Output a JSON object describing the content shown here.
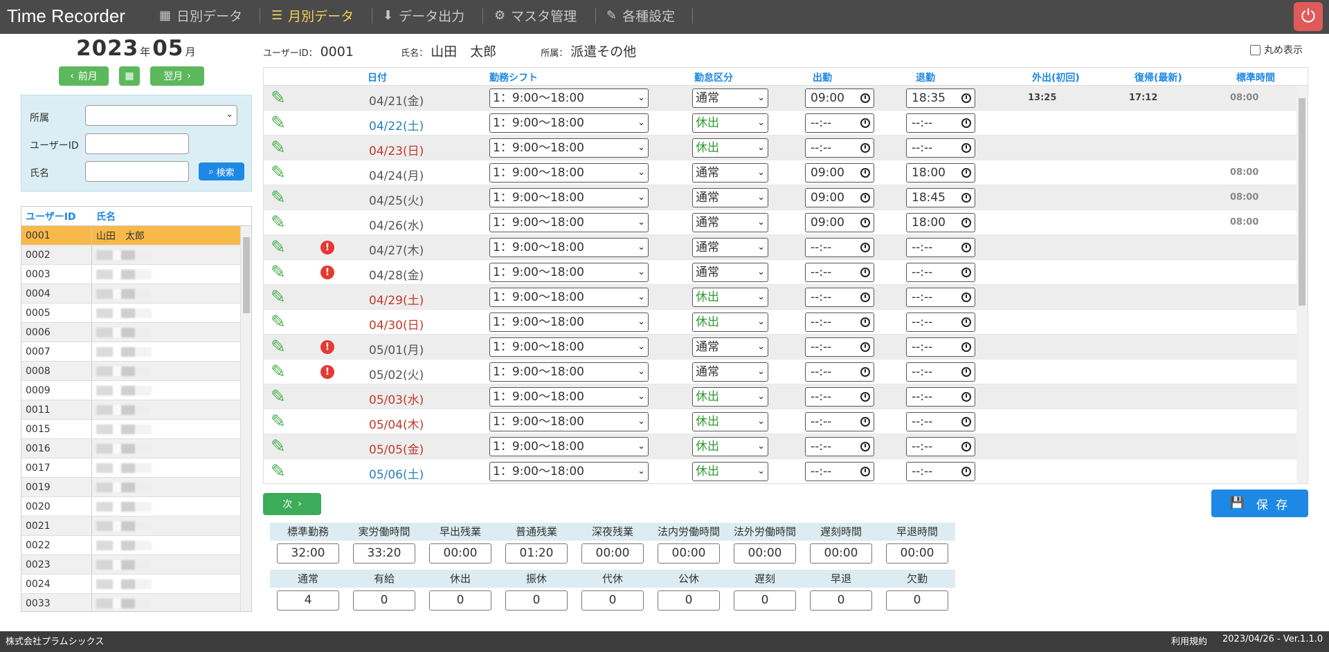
{
  "app": {
    "title": "Time Recorder"
  },
  "nav": [
    {
      "label": "日別データ",
      "icon": "calendar-icon"
    },
    {
      "label": "月別データ",
      "icon": "list-icon"
    },
    {
      "label": "データ出力",
      "icon": "download-icon"
    },
    {
      "label": "マスタ管理",
      "icon": "gear-icon"
    },
    {
      "label": "各種設定",
      "icon": "wrench-icon"
    }
  ],
  "period": {
    "year": "2023",
    "year_unit": "年",
    "month": "05",
    "month_unit": "月",
    "prev_label": "前月",
    "next_label": "翌月"
  },
  "search": {
    "dept_label": "所属",
    "dept_value": "",
    "uid_label": "ユーザーID",
    "uid_value": "",
    "name_label": "氏名",
    "name_value": "",
    "search_label": "検索"
  },
  "users": {
    "headers": {
      "id": "ユーザーID",
      "name": "氏名"
    },
    "rows": [
      {
        "id": "0001",
        "name": "山田　太郎"
      },
      {
        "id": "0002",
        "name": ""
      },
      {
        "id": "0003",
        "name": ""
      },
      {
        "id": "0004",
        "name": ""
      },
      {
        "id": "0005",
        "name": ""
      },
      {
        "id": "0006",
        "name": ""
      },
      {
        "id": "0007",
        "name": ""
      },
      {
        "id": "0008",
        "name": ""
      },
      {
        "id": "0009",
        "name": ""
      },
      {
        "id": "0011",
        "name": ""
      },
      {
        "id": "0015",
        "name": ""
      },
      {
        "id": "0016",
        "name": ""
      },
      {
        "id": "0017",
        "name": ""
      },
      {
        "id": "0019",
        "name": ""
      },
      {
        "id": "0020",
        "name": ""
      },
      {
        "id": "0021",
        "name": ""
      },
      {
        "id": "0022",
        "name": ""
      },
      {
        "id": "0023",
        "name": ""
      },
      {
        "id": "0024",
        "name": ""
      },
      {
        "id": "0033",
        "name": ""
      }
    ]
  },
  "user_info": {
    "uid_label": "ユーザーID：",
    "uid": "0001",
    "name_label": "氏名：",
    "name": "山田　太郎",
    "dept_label": "所属：",
    "dept": "派遣その他"
  },
  "rounding_label": "丸め表示",
  "table": {
    "headers": {
      "date": "日付",
      "shift": "勤務シフト",
      "kind": "勤怠区分",
      "in": "出勤",
      "out": "退勤",
      "goout": "外出(初回)",
      "return": "復帰(最新)",
      "std": "標準時間"
    },
    "rows": [
      {
        "date": "04/21(金)",
        "day": "wk",
        "err": false,
        "shift": "1：9:00～18:00",
        "kind": "通常",
        "in": "09:00",
        "out": "18:35",
        "goout": "13:25",
        "ret": "17:12",
        "std": "08:00"
      },
      {
        "date": "04/22(土)",
        "day": "sat",
        "err": false,
        "shift": "1：9:00～18:00",
        "kind": "休出",
        "in": "--:--",
        "out": "--:--",
        "goout": "",
        "ret": "",
        "std": ""
      },
      {
        "date": "04/23(日)",
        "day": "sun",
        "err": false,
        "shift": "1：9:00～18:00",
        "kind": "休出",
        "in": "--:--",
        "out": "--:--",
        "goout": "",
        "ret": "",
        "std": ""
      },
      {
        "date": "04/24(月)",
        "day": "wk",
        "err": false,
        "shift": "1：9:00～18:00",
        "kind": "通常",
        "in": "09:00",
        "out": "18:00",
        "goout": "",
        "ret": "",
        "std": "08:00"
      },
      {
        "date": "04/25(火)",
        "day": "wk",
        "err": false,
        "shift": "1：9:00～18:00",
        "kind": "通常",
        "in": "09:00",
        "out": "18:45",
        "goout": "",
        "ret": "",
        "std": "08:00"
      },
      {
        "date": "04/26(水)",
        "day": "wk",
        "err": false,
        "shift": "1：9:00～18:00",
        "kind": "通常",
        "in": "09:00",
        "out": "18:00",
        "goout": "",
        "ret": "",
        "std": "08:00"
      },
      {
        "date": "04/27(木)",
        "day": "wk",
        "err": true,
        "shift": "1：9:00～18:00",
        "kind": "通常",
        "in": "--:--",
        "out": "--:--",
        "goout": "",
        "ret": "",
        "std": ""
      },
      {
        "date": "04/28(金)",
        "day": "wk",
        "err": true,
        "shift": "1：9:00～18:00",
        "kind": "通常",
        "in": "--:--",
        "out": "--:--",
        "goout": "",
        "ret": "",
        "std": ""
      },
      {
        "date": "04/29(土)",
        "day": "sun",
        "err": false,
        "shift": "1：9:00～18:00",
        "kind": "休出",
        "in": "--:--",
        "out": "--:--",
        "goout": "",
        "ret": "",
        "std": ""
      },
      {
        "date": "04/30(日)",
        "day": "sun",
        "err": false,
        "shift": "1：9:00～18:00",
        "kind": "休出",
        "in": "--:--",
        "out": "--:--",
        "goout": "",
        "ret": "",
        "std": ""
      },
      {
        "date": "05/01(月)",
        "day": "wk",
        "err": true,
        "shift": "1：9:00～18:00",
        "kind": "通常",
        "in": "--:--",
        "out": "--:--",
        "goout": "",
        "ret": "",
        "std": ""
      },
      {
        "date": "05/02(火)",
        "day": "wk",
        "err": true,
        "shift": "1：9:00～18:00",
        "kind": "通常",
        "in": "--:--",
        "out": "--:--",
        "goout": "",
        "ret": "",
        "std": ""
      },
      {
        "date": "05/03(水)",
        "day": "sun",
        "err": false,
        "shift": "1：9:00～18:00",
        "kind": "休出",
        "in": "--:--",
        "out": "--:--",
        "goout": "",
        "ret": "",
        "std": ""
      },
      {
        "date": "05/04(木)",
        "day": "sun",
        "err": false,
        "shift": "1：9:00～18:00",
        "kind": "休出",
        "in": "--:--",
        "out": "--:--",
        "goout": "",
        "ret": "",
        "std": ""
      },
      {
        "date": "05/05(金)",
        "day": "sun",
        "err": false,
        "shift": "1：9:00～18:00",
        "kind": "休出",
        "in": "--:--",
        "out": "--:--",
        "goout": "",
        "ret": "",
        "std": ""
      },
      {
        "date": "05/06(土)",
        "day": "sat",
        "err": false,
        "shift": "1：9:00～18:00",
        "kind": "休出",
        "in": "--:--",
        "out": "--:--",
        "goout": "",
        "ret": "",
        "std": ""
      }
    ]
  },
  "next_label": "次",
  "save_label": "保 存",
  "summary1": {
    "labels": [
      "標準勤務",
      "実労働時間",
      "早出残業",
      "普通残業",
      "深夜残業",
      "法内労働時間",
      "法外労働時間",
      "遅刻時間",
      "早退時間"
    ],
    "values": [
      "32:00",
      "33:20",
      "00:00",
      "01:20",
      "00:00",
      "00:00",
      "00:00",
      "00:00",
      "00:00"
    ]
  },
  "summary2": {
    "labels": [
      "通常",
      "有給",
      "休出",
      "振休",
      "代休",
      "公休",
      "遅刻",
      "早退",
      "欠勤"
    ],
    "values": [
      "4",
      "0",
      "0",
      "0",
      "0",
      "0",
      "0",
      "0",
      "0"
    ]
  },
  "footer": {
    "company": "株式会社プラムシックス",
    "terms": "利用規約",
    "version": "2023/04/26 - Ver.1.1.0"
  }
}
